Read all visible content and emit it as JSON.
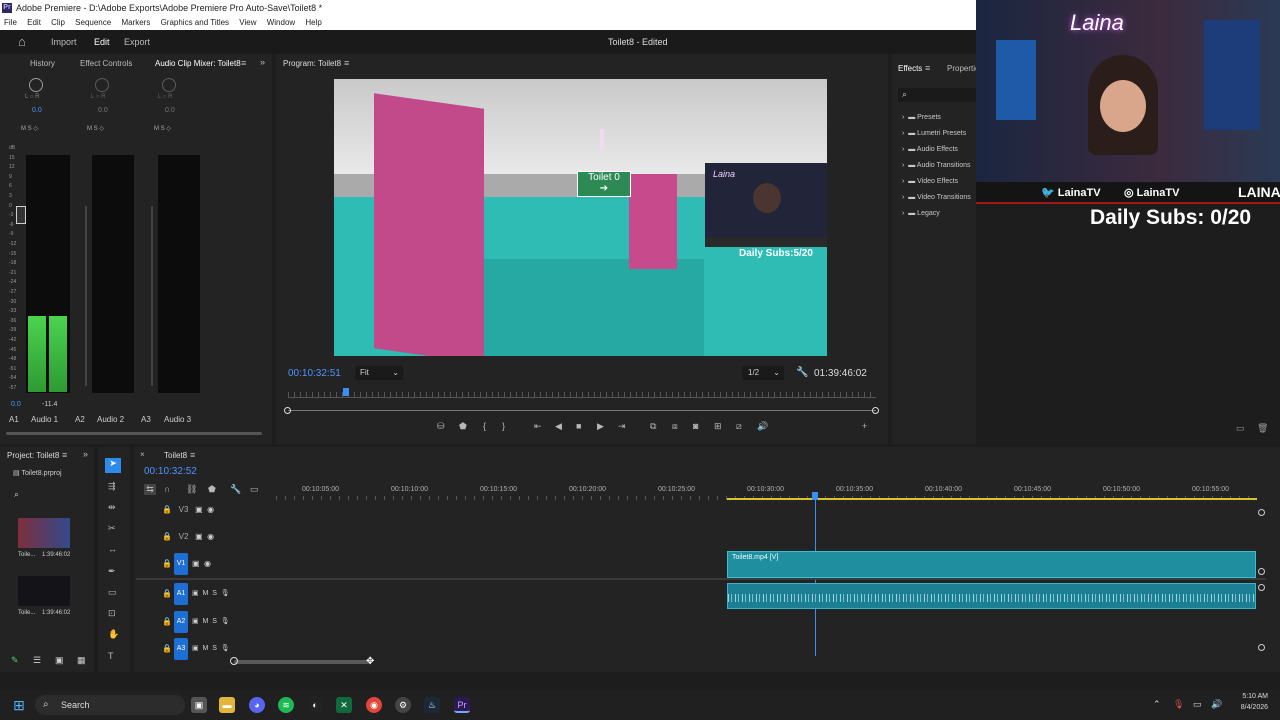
{
  "window": {
    "title": "Adobe Premiere - D:\\Adobe Exports\\Adobe Premiere Pro Auto-Save\\Toilet8 *",
    "app_icon": "Pr"
  },
  "menu": [
    "File",
    "Edit",
    "Clip",
    "Sequence",
    "Markers",
    "Graphics and Titles",
    "View",
    "Window",
    "Help"
  ],
  "topnav": {
    "tabs": [
      "Import",
      "Edit",
      "Export"
    ],
    "active": "Edit",
    "doc_title": "Toilet8 - Edited"
  },
  "mixer_panel": {
    "tabs": [
      "History",
      "Effect Controls",
      "Audio Clip Mixer: Toilet8"
    ],
    "channels": [
      {
        "lr": "L ○ R",
        "value": "0.0",
        "ms": "M  S  ◇",
        "peak": "0.0",
        "peak2": "-11.4",
        "tag": "A1",
        "name": "Audio 1"
      },
      {
        "lr": "L ○ R",
        "value": "0.0",
        "ms": "M  S  ◇",
        "tag": "A2",
        "name": "Audio 2"
      },
      {
        "lr": "L ○ R",
        "value": "0.0",
        "ms": "M  S  ◇",
        "tag": "A3",
        "name": "Audio 3"
      }
    ],
    "db_scale": [
      "dB",
      "15",
      "12",
      "9",
      "6",
      "3",
      "0",
      "-3",
      "-6",
      "-9",
      "-12",
      "-15",
      "-18",
      "-21",
      "-24",
      "-27",
      "-30",
      "-33",
      "-36",
      "-39",
      "-42",
      "-45",
      "-48",
      "-51",
      "-54",
      "-57"
    ]
  },
  "program_monitor": {
    "tab": "Program: Toilet8",
    "timecode": "00:10:32:51",
    "fit": "Fit",
    "resolution": "1/2",
    "duration": "01:39:46:02",
    "video_sign": "Toilet 0",
    "overlay_name": "Laina",
    "overlay_subs": "Daily Subs:5/20"
  },
  "effects_panel": {
    "tabs": [
      "Effects",
      "Properties"
    ],
    "items": [
      "Presets",
      "Lumetri Presets",
      "Audio Effects",
      "Audio Transitions",
      "Video Effects",
      "Video Transitions",
      "Legacy"
    ]
  },
  "webcam": {
    "name": "Laina",
    "social": [
      "LainaTV",
      "LainaTV",
      "LAINA"
    ],
    "daily_subs": "Daily Subs: 0/20"
  },
  "project_panel": {
    "tab": "Project: Toilet8",
    "file": "Toilet8.prproj",
    "items": [
      {
        "name": "Toile...",
        "duration": "1:39:46:02"
      },
      {
        "name": "Toile...",
        "duration": "1:39:46:02"
      }
    ]
  },
  "timeline": {
    "tab": "Toilet8",
    "timecode": "00:10:32:52",
    "ruler": [
      "00:10:05:00",
      "00:10:10:00",
      "00:10:15:00",
      "00:10:20:00",
      "00:10:25:00",
      "00:10:30:00",
      "00:10:35:00",
      "00:10:40:00",
      "00:10:45:00",
      "00:10:50:00",
      "00:10:55:00"
    ],
    "video_tracks": [
      "V3",
      "V2",
      "V1"
    ],
    "audio_tracks": [
      "A1",
      "A2",
      "A3"
    ],
    "clip_label": "Toilet8.mp4 [V]"
  },
  "taskbar": {
    "search": "Search",
    "time": "5:10 AM",
    "date": "8/4/2026"
  },
  "colors": {
    "accent": "#2d8ceb",
    "clip": "#1f8fa0",
    "audio_clip": "#1c7f93",
    "meter": "#46c34a"
  }
}
